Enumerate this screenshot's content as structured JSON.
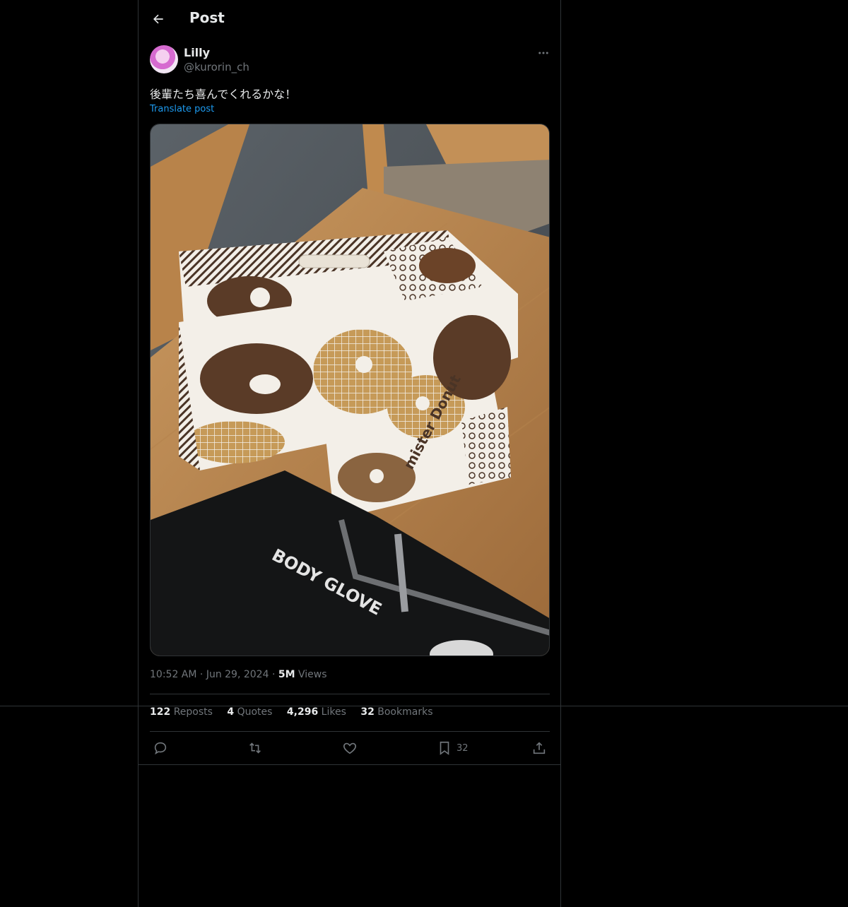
{
  "header": {
    "title": "Post"
  },
  "post": {
    "author_name": "Lilly",
    "author_handle": "@kurorin_ch",
    "text": "後輩たち喜んでくれるかな！",
    "translate_label": "Translate post",
    "time": "10:52 AM",
    "separator": "·",
    "date": "Jun 29, 2024",
    "views_count": "5M",
    "views_label": "Views",
    "image_text": {
      "brand_line1": "mister",
      "brand_line2": "Donut",
      "bag_logo": "BODY GLOVE"
    }
  },
  "stats": {
    "reposts_count": "122",
    "reposts_label": "Reposts",
    "quotes_count": "4",
    "quotes_label": "Quotes",
    "likes_count": "4,296",
    "likes_label": "Likes",
    "bookmarks_count": "32",
    "bookmarks_label": "Bookmarks"
  },
  "actions": {
    "bookmark_count": "32"
  },
  "colors": {
    "accent": "#1d9bf0",
    "text": "#e7e9ea",
    "muted": "#71767b",
    "border": "#2f3336"
  }
}
